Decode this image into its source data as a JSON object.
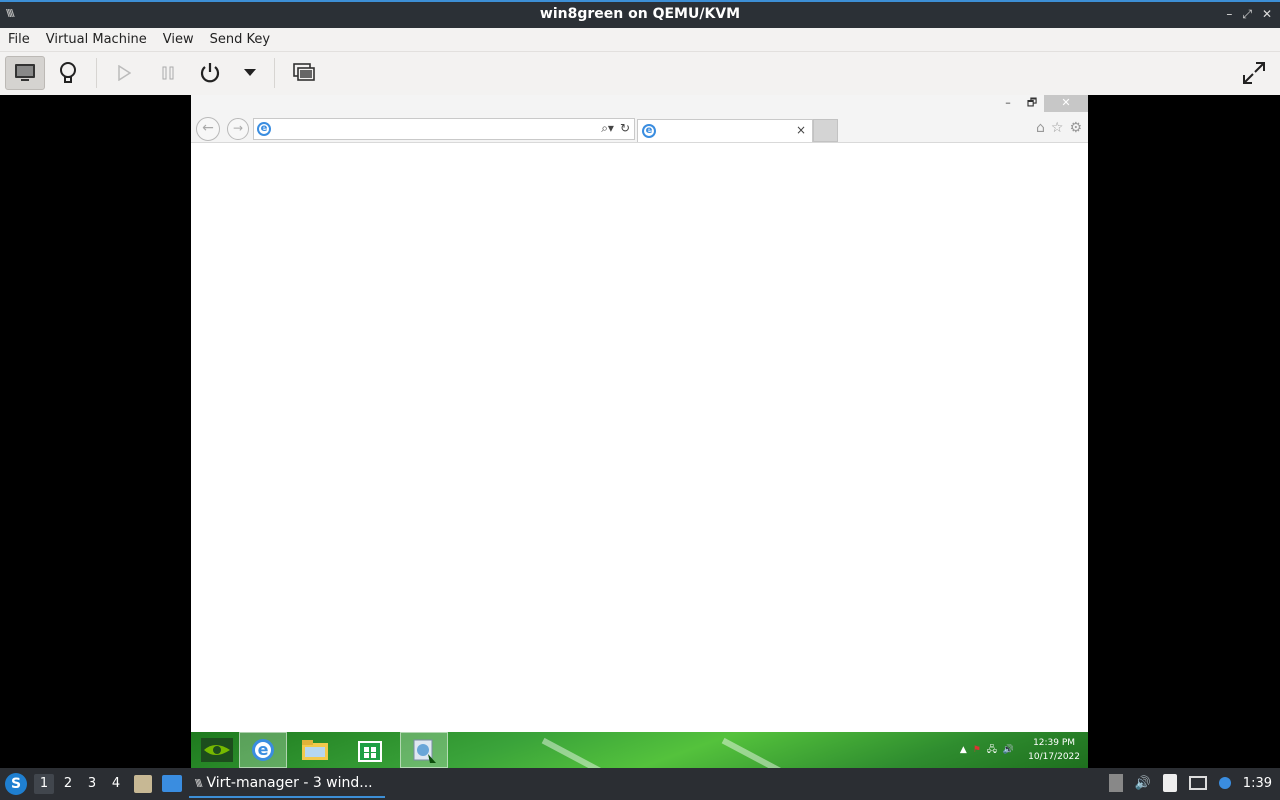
{
  "window": {
    "title": "win8green on QEMU/KVM",
    "controls": [
      "–",
      "⤢",
      "✕"
    ]
  },
  "menu": {
    "items": [
      "File",
      "Virtual Machine",
      "View",
      "Send Key"
    ]
  },
  "toolbar": {
    "buttons": [
      "console-view",
      "details-lightbulb",
      "run",
      "pause",
      "power",
      "power-menu",
      "snapshots",
      "fullscreen"
    ]
  },
  "vm": {
    "ie": {
      "address_value": "",
      "tab_title": "",
      "tab_close": "×",
      "window_controls": [
        "–",
        "🗗",
        "✕"
      ]
    },
    "taskbar": {
      "clock_time": "12:39 PM",
      "clock_date": "10/17/2022"
    }
  },
  "panel": {
    "workspaces": [
      "1",
      "2",
      "3",
      "4"
    ],
    "active_workspace": "1",
    "task_label": "Virt-manager - 3 wind...",
    "time": "1:39"
  },
  "colors": {
    "accent": "#3d8fd6",
    "win8_green": "#3aa33a",
    "panel": "#2b2e33"
  }
}
